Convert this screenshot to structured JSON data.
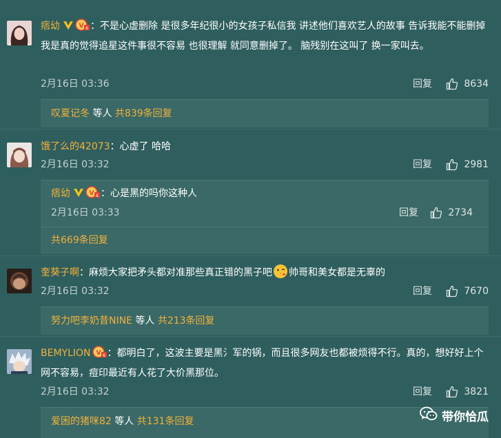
{
  "comments": [
    {
      "user": "痞幼",
      "text": "：不是心虚删除 是很多年纪很小的女孩子私信我 讲述他们喜欢艺人的故事 告诉我能不能删掉 我是真的觉得追星这件事很不容易 也很理解 就同意删掉了。 脑残别在这叫了 换一家叫去。",
      "time": "2月16日 03:36",
      "reply_label": "回复",
      "likes": "8634",
      "thread_users": "叹夏记冬",
      "thread_waiting": " 等人 ",
      "thread_count": "共839条回复"
    },
    {
      "user": "饿了么的42073",
      "text": "：心虚了 哈哈",
      "time": "2月16日 03:32",
      "reply_label": "回复",
      "likes": "2981",
      "sub_reply": {
        "user": "痞幼",
        "text": "：心是黑的吗你这种人",
        "time": "2月16日 03:33",
        "reply_label": "回复",
        "likes": "2734"
      },
      "thread_count": "共669条回复"
    },
    {
      "user": "奎葵子啊",
      "text_before": "：麻烦大家把矛头都对准那些真正错的黑子吧",
      "text_after": "帅哥和美女都是无辜的",
      "time": "2月16日 03:32",
      "reply_label": "回复",
      "likes": "7670",
      "thread_users": "努力吧李奶昔NINE",
      "thread_waiting": " 等人 ",
      "thread_count": "共213条回复"
    },
    {
      "user": "BEMYLION",
      "text": "：都明白了，这波主要是黑氵军的锅，而且很多网友也都被烦得不行。真的，想好好上个网不容易，痘印最近有人花了大价黑那位。",
      "time": "2月16日 03:32",
      "reply_label": "回复",
      "likes": "3821",
      "thread_users": "爱困的猪咪82",
      "thread_waiting": " 等人 ",
      "thread_count": "共131条回复"
    }
  ],
  "watermark": "带你恰瓜",
  "icons": [
    "verified-v-icon",
    "member-badge-icon",
    "thumbs-up-icon",
    "emoji-kiss-icon",
    "wechat-icon"
  ],
  "colors": {
    "background": "#2f5e5e",
    "username": "#f3b23a",
    "reply_box": "#3a6967"
  }
}
